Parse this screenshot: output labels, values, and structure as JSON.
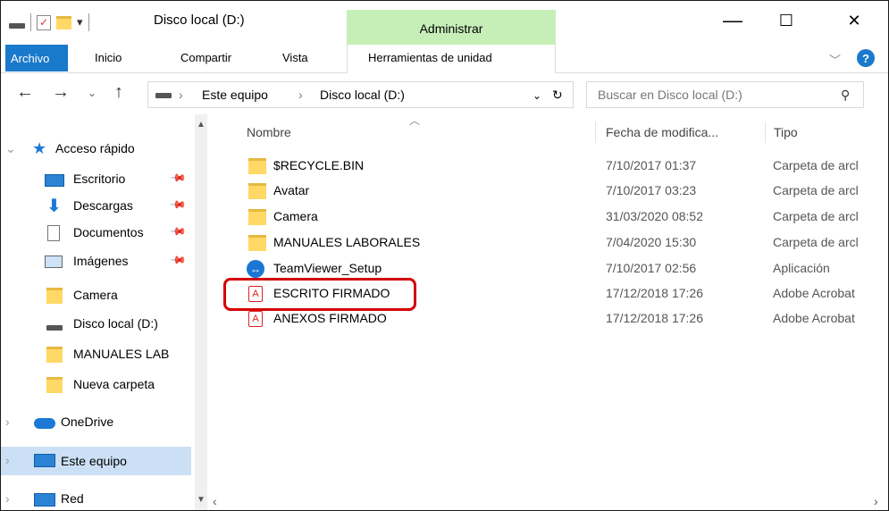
{
  "window": {
    "title": "Disco local (D:)",
    "contextual_tab": "Administrar",
    "controls": {
      "minimize": "—",
      "maximize": "☐",
      "close": "✕"
    }
  },
  "ribbon": {
    "tabs": [
      "Archivo",
      "Inicio",
      "Compartir",
      "Vista",
      "Herramientas de unidad"
    ],
    "help_label": "?"
  },
  "address": {
    "crumbs": [
      "Este equipo",
      "Disco local (D:)"
    ],
    "search_placeholder": "Buscar en Disco local (D:)"
  },
  "nav": {
    "quick_access": "Acceso rápido",
    "items": [
      {
        "label": "Escritorio",
        "icon": "desktop-icon",
        "pinned": true
      },
      {
        "label": "Descargas",
        "icon": "download-icon",
        "pinned": true
      },
      {
        "label": "Documentos",
        "icon": "documents-icon",
        "pinned": true
      },
      {
        "label": "Imágenes",
        "icon": "pictures-icon",
        "pinned": true
      },
      {
        "label": "Camera",
        "icon": "folder-icon",
        "pinned": false
      },
      {
        "label": "Disco local (D:)",
        "icon": "drive-icon",
        "pinned": false
      },
      {
        "label": "MANUALES LAB",
        "icon": "folder-icon",
        "pinned": false
      },
      {
        "label": "Nueva carpeta",
        "icon": "folder-icon",
        "pinned": false
      }
    ],
    "onedrive": "OneDrive",
    "this_pc": "Este equipo",
    "network": "Red"
  },
  "columns": {
    "name": "Nombre",
    "date": "Fecha de modifica...",
    "type": "Tipo"
  },
  "files": [
    {
      "name": "$RECYCLE.BIN",
      "date": "7/10/2017 01:37",
      "type": "Carpeta de arcl",
      "icon": "folder-icon"
    },
    {
      "name": "Avatar",
      "date": "7/10/2017 03:23",
      "type": "Carpeta de arcl",
      "icon": "folder-icon"
    },
    {
      "name": "Camera",
      "date": "31/03/2020 08:52",
      "type": "Carpeta de arcl",
      "icon": "folder-icon"
    },
    {
      "name": "MANUALES LABORALES",
      "date": "7/04/2020 15:30",
      "type": "Carpeta de arcl",
      "icon": "folder-icon"
    },
    {
      "name": "TeamViewer_Setup",
      "date": "7/10/2017 02:56",
      "type": "Aplicación",
      "icon": "teamviewer-icon"
    },
    {
      "name": "ESCRITO FIRMADO",
      "date": "17/12/2018 17:26",
      "type": "Adobe Acrobat",
      "icon": "pdf-icon"
    },
    {
      "name": "ANEXOS FIRMADO",
      "date": "17/12/2018 17:26",
      "type": "Adobe Acrobat",
      "icon": "pdf-icon"
    }
  ],
  "colors": {
    "accent": "#1979ca",
    "admin_tab": "#c6efb8",
    "highlight": "#d40000",
    "folder": "#ffd866"
  }
}
